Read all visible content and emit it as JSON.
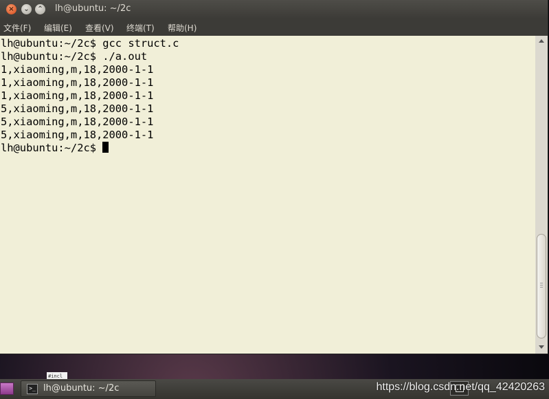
{
  "window": {
    "title": "lh@ubuntu: ~/2c",
    "buttons": {
      "close_icon": "close-icon",
      "minimize_icon": "minimize-icon",
      "maximize_icon": "maximize-icon"
    }
  },
  "menubar": {
    "items": [
      {
        "label": "文件(F)"
      },
      {
        "label": "编辑(E)"
      },
      {
        "label": "查看(V)"
      },
      {
        "label": "终端(T)"
      },
      {
        "label": "帮助(H)"
      }
    ]
  },
  "terminal": {
    "background_color": "#f1efd8",
    "text_color": "#000000",
    "lines": [
      "lh@ubuntu:~/2c$ gcc struct.c",
      "lh@ubuntu:~/2c$ ./a.out",
      "1,xiaoming,m,18,2000-1-1",
      "1,xiaoming,m,18,2000-1-1",
      "1,xiaoming,m,18,2000-1-1",
      "5,xiaoming,m,18,2000-1-1",
      "5,xiaoming,m,18,2000-1-1",
      "5,xiaoming,m,18,2000-1-1",
      "lh@ubuntu:~/2c$ "
    ]
  },
  "desktop": {
    "file_label": "#incl"
  },
  "taskbar": {
    "task_label": "lh@ubuntu: ~/2c",
    "task_icon": "terminal-icon",
    "watermark": "https://blog.csdn.net/qq_42420263"
  }
}
